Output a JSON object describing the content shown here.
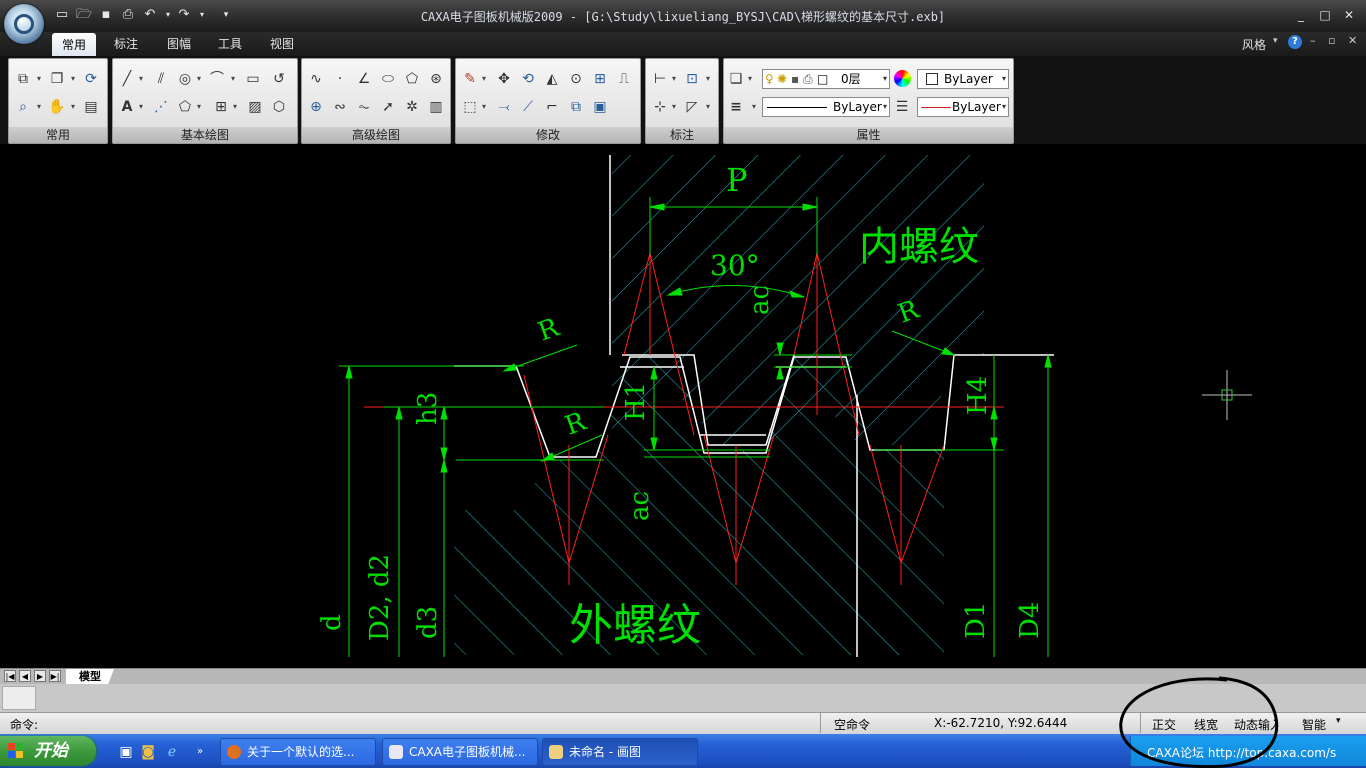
{
  "window": {
    "title": "CAXA电子图板机械版2009 - [G:\\Study\\lixueliang_BYSJ\\CAD\\梯形螺纹的基本尺寸.exb]",
    "controls": [
      "_",
      "□",
      "✕"
    ]
  },
  "quick_access": [
    "new-icon",
    "open-icon",
    "save-icon",
    "print-icon",
    "undo-icon",
    "redo-icon",
    "customize-icon"
  ],
  "ribbon": {
    "tabs": [
      "常用",
      "标注",
      "图幅",
      "工具",
      "视图"
    ],
    "active_tab": "常用",
    "style_label": "风格",
    "panels": [
      "常用",
      "基本绘图",
      "高级绘图",
      "修改",
      "标注",
      "属性"
    ],
    "properties": {
      "layer": "0层",
      "color": "ByLayer",
      "linetype": "ByLayer",
      "lineweight": "ByLayer"
    }
  },
  "drawing": {
    "labels": {
      "internal_thread": "内螺纹",
      "external_thread": "外螺纹",
      "pitch": "P",
      "angle": "30°",
      "ac_top": "ac",
      "ac_bottom": "ac",
      "r1": "R",
      "r2": "R",
      "r3": "R",
      "h3": "h3",
      "H1": "H1",
      "H4": "H4",
      "d": "d",
      "d2": "D2, d2",
      "d3": "d3",
      "D1": "D1",
      "D4": "D4"
    }
  },
  "sheet_tabs": {
    "nav": [
      "|◀",
      "◀",
      "▶",
      "▶|"
    ],
    "active": "模型"
  },
  "command": {
    "prompt": "命令:"
  },
  "status": {
    "mode": "空命令",
    "coords": "X:-62.7210, Y:92.6444",
    "toggles": [
      "正交",
      "线宽",
      "动态输入",
      "智能"
    ]
  },
  "taskbar": {
    "start_label": "开始",
    "items": [
      {
        "label": "关于一个默认的选...",
        "active": false
      },
      {
        "label": "CAXA电子图板机械...",
        "active": false
      },
      {
        "label": "未命名 - 画图",
        "active": true
      }
    ],
    "tray_text": "CAXA论坛 http://top.caxa.com/s"
  },
  "colors": {
    "dimension": "#00e000",
    "outline": "#ffffff",
    "centerline": "#ff2020",
    "hatch": "#2ab0c0",
    "accent": "#2561d6"
  }
}
